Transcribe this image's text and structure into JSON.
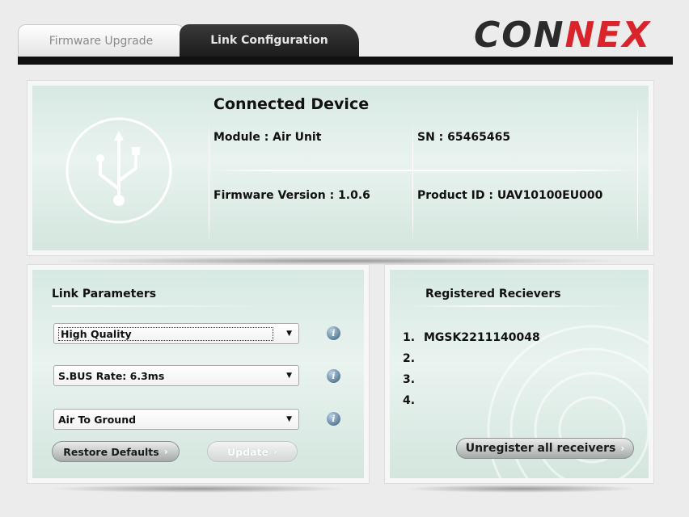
{
  "tabs": [
    {
      "label": "Firmware Upgrade",
      "active": false
    },
    {
      "label": "Link Configuration",
      "active": true
    }
  ],
  "logo": {
    "text": "CONNEX",
    "colors": {
      "dark": "#2b2b2b",
      "accent": "#d9242b"
    }
  },
  "device": {
    "title": "Connected Device",
    "icon": "usb-icon",
    "module": "Module : Air Unit",
    "sn": "SN : 65465465",
    "firmware": "Firmware Version : 1.0.6",
    "product_id": "Product ID : UAV10100EU000"
  },
  "link_params": {
    "title": "Link Parameters",
    "selects": [
      {
        "value": "High Quality",
        "focused": true
      },
      {
        "value": "S.BUS Rate: 6.3ms",
        "focused": false
      },
      {
        "value": "Air To Ground",
        "focused": false
      }
    ],
    "info_icon": "info-icon",
    "restore_label": "Restore Defaults",
    "update_label": "Update",
    "update_enabled": false
  },
  "receivers": {
    "title": "Registered Recievers",
    "items": [
      {
        "num": "1.",
        "name": "MGSK2211140048"
      },
      {
        "num": "2.",
        "name": ""
      },
      {
        "num": "3.",
        "name": ""
      },
      {
        "num": "4.",
        "name": ""
      }
    ],
    "unregister_label": "Unregister all receivers"
  }
}
